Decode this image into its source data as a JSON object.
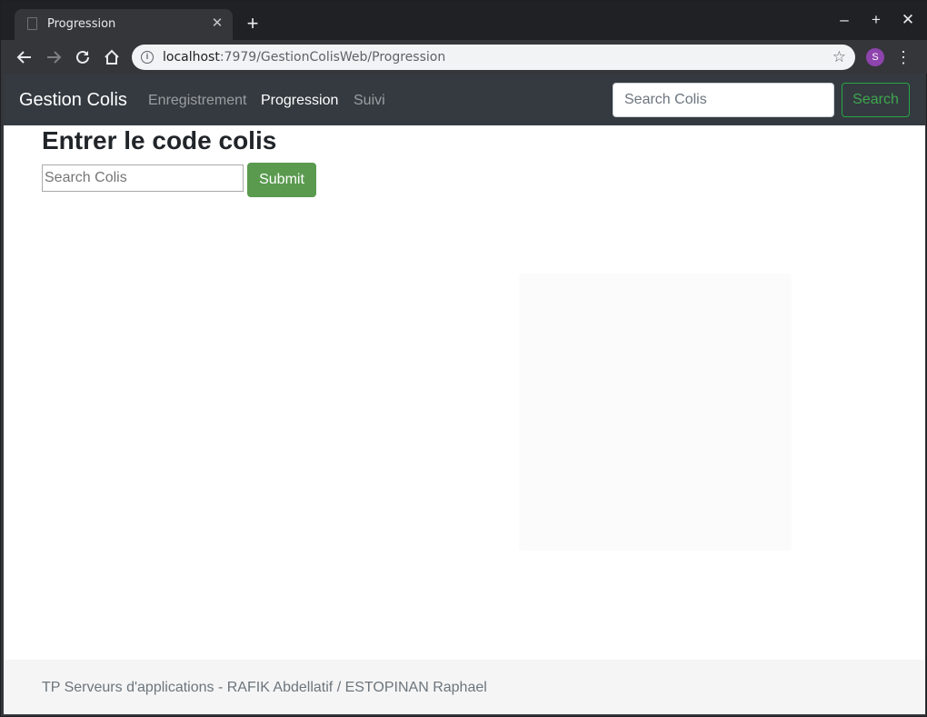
{
  "browser": {
    "tab_title": "Progression",
    "url_host": "localhost",
    "url_rest": ":7979/GestionColisWeb/Progression",
    "profile_initial": "S",
    "icons": {
      "tab_close": "close-icon",
      "new_tab": "plus-icon",
      "back": "arrow-left-icon",
      "forward": "arrow-right-icon",
      "reload": "reload-icon",
      "home": "home-icon",
      "info": "info-icon",
      "bookmark": "star-icon",
      "menu": "kebab-menu-icon",
      "minimize": "minimize-icon",
      "maximize": "maximize-icon",
      "close": "close-icon"
    }
  },
  "navbar": {
    "brand": "Gestion Colis",
    "links": [
      {
        "label": "Enregistrement",
        "active": false
      },
      {
        "label": "Progression",
        "active": true
      },
      {
        "label": "Suivi",
        "active": false
      }
    ],
    "search_placeholder": "Search Colis",
    "search_button": "Search"
  },
  "main": {
    "heading": "Entrer le code colis",
    "input_placeholder": "Search Colis",
    "submit_label": "Submit"
  },
  "footer": {
    "text": "TP Serveurs d'applications - RAFIK Abdellatif / ESTOPINAN Raphael"
  },
  "colors": {
    "navbar_bg": "#343a40",
    "success": "#28a745",
    "submit_bg": "#5a9a4f",
    "footer_bg": "#f5f5f5"
  }
}
